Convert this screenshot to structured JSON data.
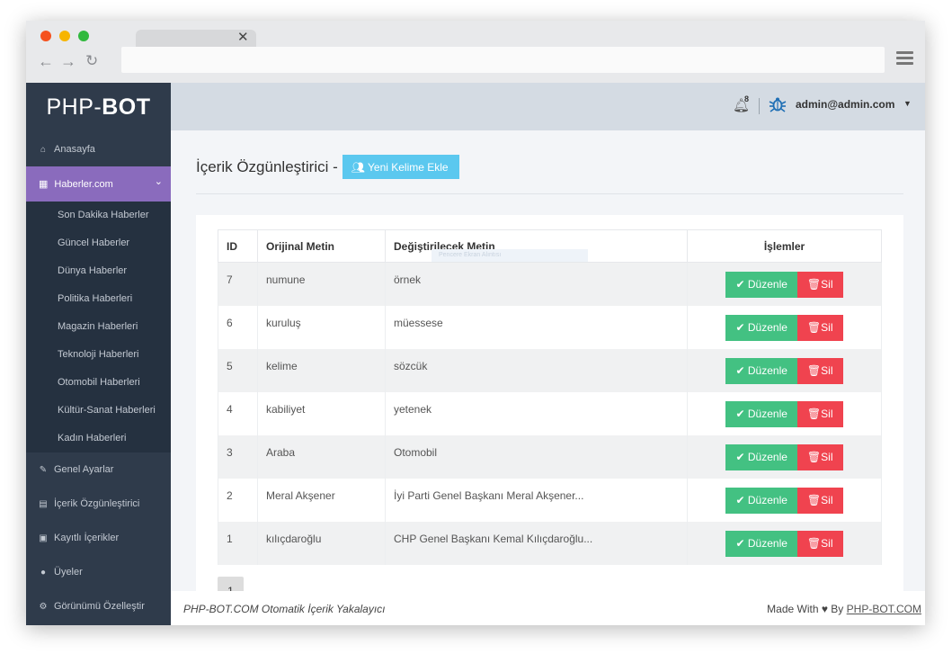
{
  "sidebar": {
    "logo_light": "PHP-",
    "logo_bold": "BOT",
    "items": [
      {
        "label": "Anasayfa",
        "icon": "home-icon"
      },
      {
        "label": "Haberler.com",
        "icon": "grid-icon",
        "active": true
      },
      {
        "label": "Genel Ayarlar",
        "icon": "wrench-icon"
      },
      {
        "label": "İçerik Özgünleştirici",
        "icon": "file-icon"
      },
      {
        "label": "Kayıtlı İçerikler",
        "icon": "save-icon"
      },
      {
        "label": "Üyeler",
        "icon": "user-icon"
      },
      {
        "label": "Görünümü Özelleştir",
        "icon": "gear-icon"
      }
    ],
    "submenu": [
      "Son Dakika Haberler",
      "Güncel Haberler",
      "Dünya Haberler",
      "Politika Haberleri",
      "Magazin Haberleri",
      "Teknoloji Haberleri",
      "Otomobil Haberleri",
      "Kültür-Sanat Haberleri",
      "Kadın Haberleri"
    ]
  },
  "topbar": {
    "notification_count": "8",
    "user_email": "admin@admin.com"
  },
  "page": {
    "title": "İçerik Özgünleştirici -",
    "add_button": "Yeni Kelime Ekle",
    "ghost_text": "Pencere Ekran Alıntısı"
  },
  "table": {
    "headers": [
      "ID",
      "Orijinal Metin",
      "Değiştirilecek Metin",
      "İşlemler"
    ],
    "rows": [
      {
        "id": "7",
        "original": "numune",
        "replacement": "örnek"
      },
      {
        "id": "6",
        "original": "kuruluş",
        "replacement": "müessese"
      },
      {
        "id": "5",
        "original": "kelime",
        "replacement": "sözcük"
      },
      {
        "id": "4",
        "original": "kabiliyet",
        "replacement": "yetenek"
      },
      {
        "id": "3",
        "original": "Araba",
        "replacement": "Otomobil"
      },
      {
        "id": "2",
        "original": "Meral Akşener",
        "replacement": "İyi Parti Genel Başkanı Meral Akşener..."
      },
      {
        "id": "1",
        "original": "kılıçdaroğlu",
        "replacement": "CHP Genel Başkanı Kemal Kılıçdaroğlu..."
      }
    ],
    "edit_label": "Düzenle",
    "delete_label": "Sil",
    "page_number": "1"
  },
  "footer": {
    "left": "PHP-BOT.COM Otomatik İçerik Yakalayıcı",
    "right_prefix": "Made With ♥ By",
    "right_link": "PHP-BOT.COM"
  },
  "colors": {
    "sidebar_bg": "#2f3b4b",
    "sidebar_active": "#8a6bbd",
    "add_button": "#5bc8ef",
    "edit_button": "#43c182",
    "delete_button": "#f0434f"
  }
}
